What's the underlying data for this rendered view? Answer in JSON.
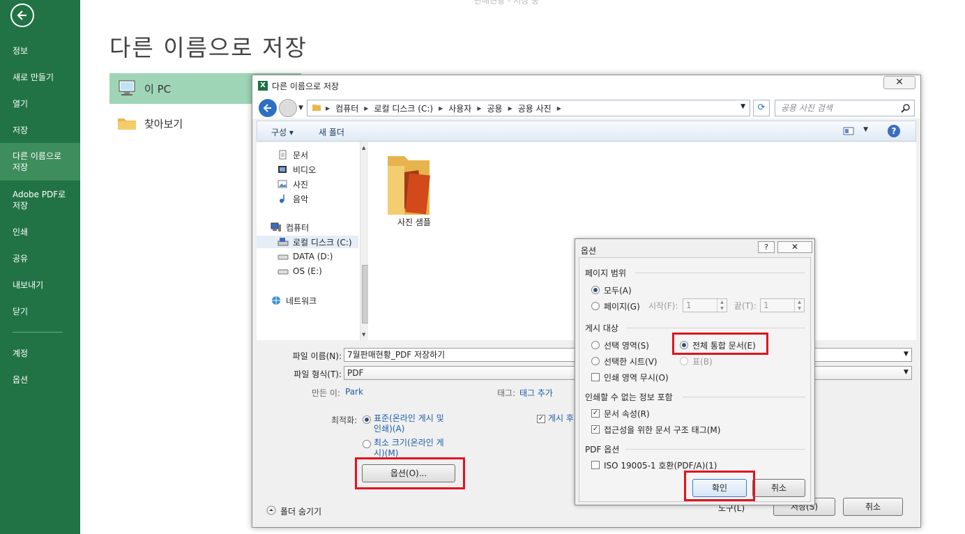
{
  "backstage": {
    "top_caption": "판매현황 - 저장 중",
    "page_title": "다른 이름으로 저장",
    "nav": [
      {
        "label": "정보"
      },
      {
        "label": "새로 만들기"
      },
      {
        "label": "열기"
      },
      {
        "label": "저장"
      },
      {
        "label": "다른 이름으로\n저장"
      },
      {
        "label": "Adobe PDF로\n저장"
      },
      {
        "label": "인쇄"
      },
      {
        "label": "공유"
      },
      {
        "label": "내보내기"
      },
      {
        "label": "닫기"
      },
      {
        "label": "계정"
      },
      {
        "label": "옵션"
      }
    ],
    "locations": [
      {
        "label": "이 PC"
      },
      {
        "label": "찾아보기"
      }
    ]
  },
  "save_dialog": {
    "title": "다른 이름으로 저장",
    "close": "✕",
    "breadcrumb": [
      "컴퓨터",
      "로컬 디스크 (C:)",
      "사용자",
      "공용",
      "공용 사진"
    ],
    "search_placeholder": "공용 사진 검색",
    "toolbar": {
      "organize": "구성 ▾",
      "new_folder": "새 폴더",
      "help": "?"
    },
    "tree": [
      {
        "label": "문서"
      },
      {
        "label": "비디오"
      },
      {
        "label": "사진"
      },
      {
        "label": "음악"
      },
      {
        "label": "컴퓨터"
      },
      {
        "label": "로컬 디스크 (C:)"
      },
      {
        "label": "DATA (D:)"
      },
      {
        "label": "OS (E:)"
      },
      {
        "label": "네트워크"
      }
    ],
    "folder": {
      "label": "사진 샘플"
    },
    "filename_label": "파일 이름(N):",
    "filename_value": "7월판매현황_PDF 저장하기",
    "filetype_label": "파일 형식(T):",
    "filetype_value": "PDF",
    "author_label": "만든 이:",
    "author_value": "Park",
    "tags_label": "태그:",
    "tags_value": "태그 추가",
    "optimize_label": "최적화:",
    "optimize_standard": "표준(온라인 게시 및\n인쇄)(A)",
    "optimize_minimum": "최소 크기(온라인 게\n시)(M)",
    "publish_check": "게시 후",
    "options_button": "옵션(O)...",
    "hide_folders": "폴더 숨기기",
    "tools": "도구(L)",
    "save_button": "저장(S)",
    "cancel_button": "취소"
  },
  "options_dialog": {
    "title": "옵션",
    "help": "?",
    "close": "✕",
    "page_range": {
      "title": "페이지 범위",
      "all": "모두(A)",
      "pages": "페이지(G)",
      "from_label": "시작(F):",
      "from_value": "1",
      "to_label": "끝(T):",
      "to_value": "1"
    },
    "publish_what": {
      "title": "게시 대상",
      "selection": "선택 영역(S)",
      "entire_workbook": "전체 통합 문서(E)",
      "active_sheets": "선택한 시트(V)",
      "table": "표(B)",
      "ignore_print_areas": "인쇄 영역 무시(O)"
    },
    "include_non_printing": {
      "title": "인쇄할 수 없는 정보 포함",
      "document_properties": "문서 속성(R)",
      "structure_tags": "접근성을 위한 문서 구조 태그(M)"
    },
    "pdf_options": {
      "title": "PDF 옵션",
      "iso": "ISO 19005-1 호환(PDF/A)(1)"
    },
    "ok_button": "확인",
    "cancel_button": "취소"
  },
  "colors": {
    "sidebar": "#217346",
    "highlight": "#e0141e",
    "link": "#1a5ca8"
  }
}
